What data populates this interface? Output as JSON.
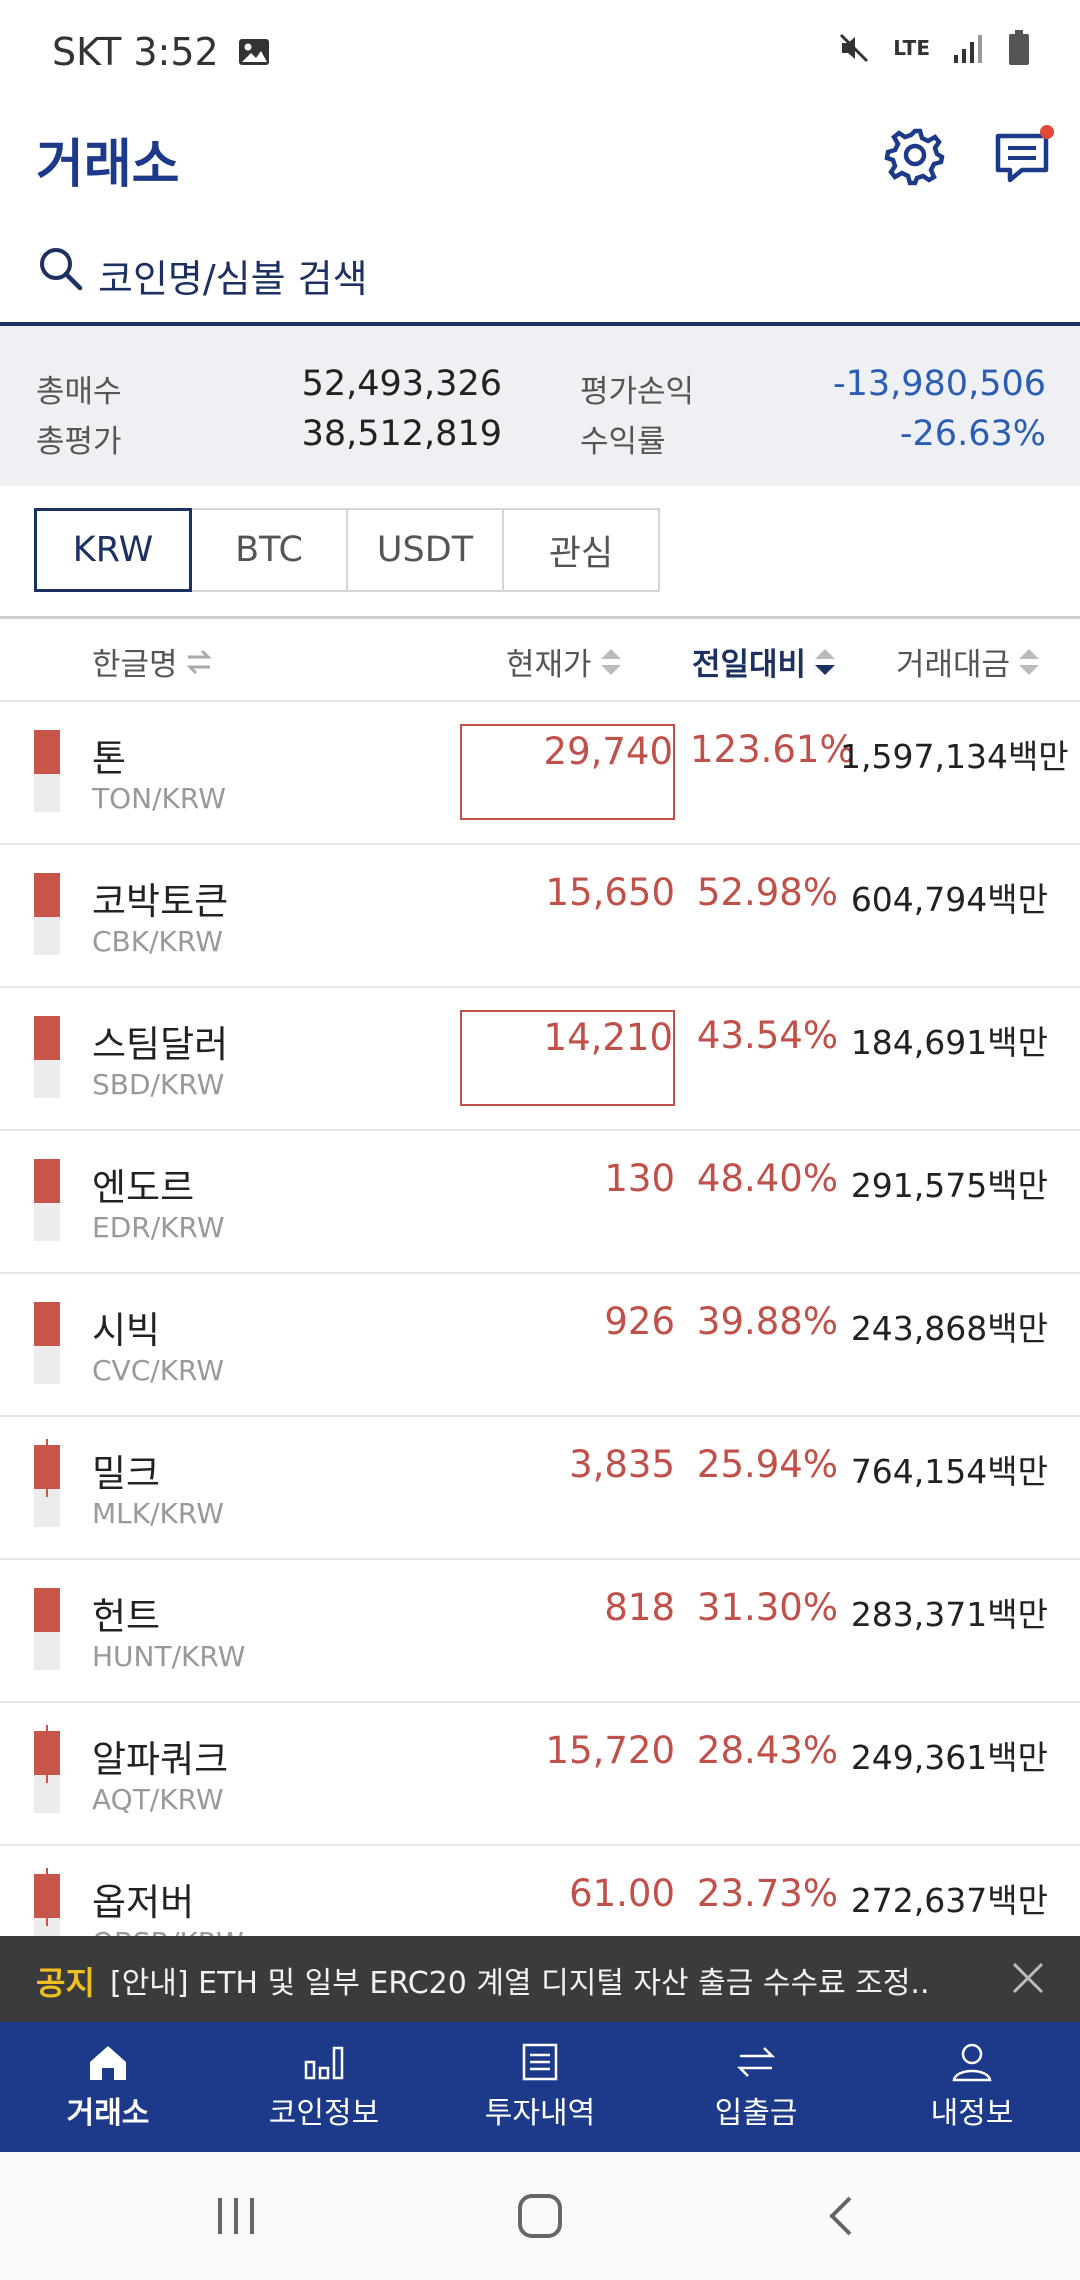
{
  "status_bar": {
    "carrier_time": "SKT 3:52",
    "network": "LTE"
  },
  "header": {
    "title": "거래소"
  },
  "search": {
    "placeholder": "코인명/심볼 검색"
  },
  "summary": {
    "total_buy_label": "총매수",
    "total_buy_value": "52,493,326",
    "total_eval_label": "총평가",
    "total_eval_value": "38,512,819",
    "pnl_label": "평가손익",
    "pnl_value": "-13,980,506",
    "yield_label": "수익률",
    "yield_value": "-26.63%"
  },
  "tabs": [
    "KRW",
    "BTC",
    "USDT",
    "관심"
  ],
  "table": {
    "headers": {
      "name": "한글명",
      "price": "현재가",
      "change": "전일대비",
      "volume": "거래대금"
    },
    "rows": [
      {
        "name": "톤",
        "symbol": "TON/KRW",
        "price": "29,740",
        "change": "123.61%",
        "volume": "1,597,134백만"
      },
      {
        "name": "코박토큰",
        "symbol": "CBK/KRW",
        "price": "15,650",
        "change": "52.98%",
        "volume": "604,794백만"
      },
      {
        "name": "스팀달러",
        "symbol": "SBD/KRW",
        "price": "14,210",
        "change": "43.54%",
        "volume": "184,691백만"
      },
      {
        "name": "엔도르",
        "symbol": "EDR/KRW",
        "price": "130",
        "change": "48.40%",
        "volume": "291,575백만"
      },
      {
        "name": "시빅",
        "symbol": "CVC/KRW",
        "price": "926",
        "change": "39.88%",
        "volume": "243,868백만"
      },
      {
        "name": "밀크",
        "symbol": "MLK/KRW",
        "price": "3,835",
        "change": "25.94%",
        "volume": "764,154백만"
      },
      {
        "name": "헌트",
        "symbol": "HUNT/KRW",
        "price": "818",
        "change": "31.30%",
        "volume": "283,371백만"
      },
      {
        "name": "알파쿼크",
        "symbol": "AQT/KRW",
        "price": "15,720",
        "change": "28.43%",
        "volume": "249,361백만"
      },
      {
        "name": "옵저버",
        "symbol": "OBSR/KRW",
        "price": "61.00",
        "change": "23.73%",
        "volume": "272,637백만"
      }
    ]
  },
  "notice": {
    "tag": "공지",
    "text": "[안내] ETH 및 일부 ERC20 계열 디지털 자산 출금 수수료 조정..."
  },
  "bottom_nav": [
    "거래소",
    "코인정보",
    "투자내역",
    "입출금",
    "내정보"
  ],
  "colors": {
    "brand": "#1d3a8a",
    "up": "#c0504a",
    "down": "#2b5db3",
    "notice_bg": "#3a3b3d"
  }
}
